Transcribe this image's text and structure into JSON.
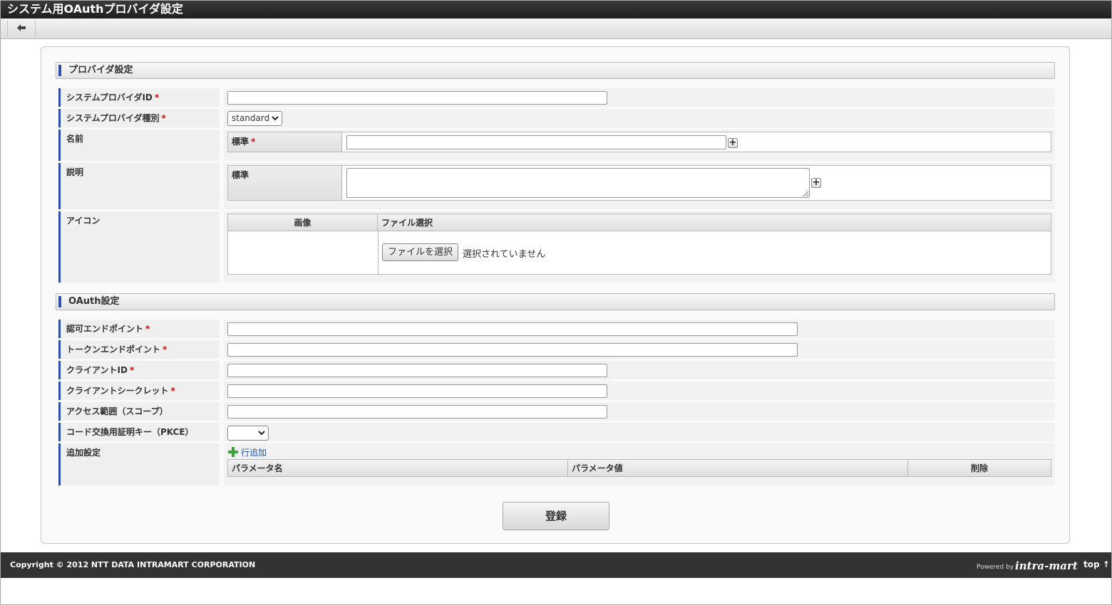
{
  "window": {
    "title": "システム用OAuthプロバイダ設定"
  },
  "toolbar": {
    "back_icon": "arrow-left-icon"
  },
  "provider_section": {
    "title": "プロバイダ設定",
    "system_provider_id": {
      "label": "システムプロバイダID",
      "required_mark": "*",
      "value": ""
    },
    "system_provider_type": {
      "label": "システムプロバイダ種別",
      "required_mark": "*",
      "selected": "standard"
    },
    "name": {
      "label": "名前",
      "sub_label": "標準",
      "required_mark": "*",
      "value": ""
    },
    "description": {
      "label": "説明",
      "sub_label": "標準",
      "value": ""
    },
    "icon": {
      "label": "アイコン",
      "col_image": "画像",
      "col_file": "ファイル選択",
      "file_button": "ファイルを選択",
      "file_status": "選択されていません"
    }
  },
  "oauth_section": {
    "title": "OAuth設定",
    "auth_endpoint": {
      "label": "認可エンドポイント",
      "required_mark": "*",
      "value": ""
    },
    "token_endpoint": {
      "label": "トークンエンドポイント",
      "required_mark": "*",
      "value": ""
    },
    "client_id": {
      "label": "クライアントID",
      "required_mark": "*",
      "value": ""
    },
    "client_secret": {
      "label": "クライアントシークレット",
      "required_mark": "*",
      "value": ""
    },
    "scope": {
      "label": "アクセス範囲（スコープ）",
      "value": ""
    },
    "pkce": {
      "label": "コード交換用証明キー（PKCE）",
      "selected": ""
    },
    "additional": {
      "label": "追加設定",
      "add_row": "行追加",
      "col_param_name": "パラメータ名",
      "col_param_value": "パラメータ値",
      "col_delete": "削除"
    }
  },
  "submit_label": "登録",
  "footer": {
    "copyright": "Copyright © 2012 NTT DATA INTRAMART CORPORATION",
    "powered_by": "Powered by",
    "logo": "intra-mart",
    "top_link": "top ↑"
  },
  "colors": {
    "accent_bar": "#2f4ea8",
    "required": "#dd0000",
    "link": "#2255aa",
    "add_icon": "#3ca23c"
  }
}
